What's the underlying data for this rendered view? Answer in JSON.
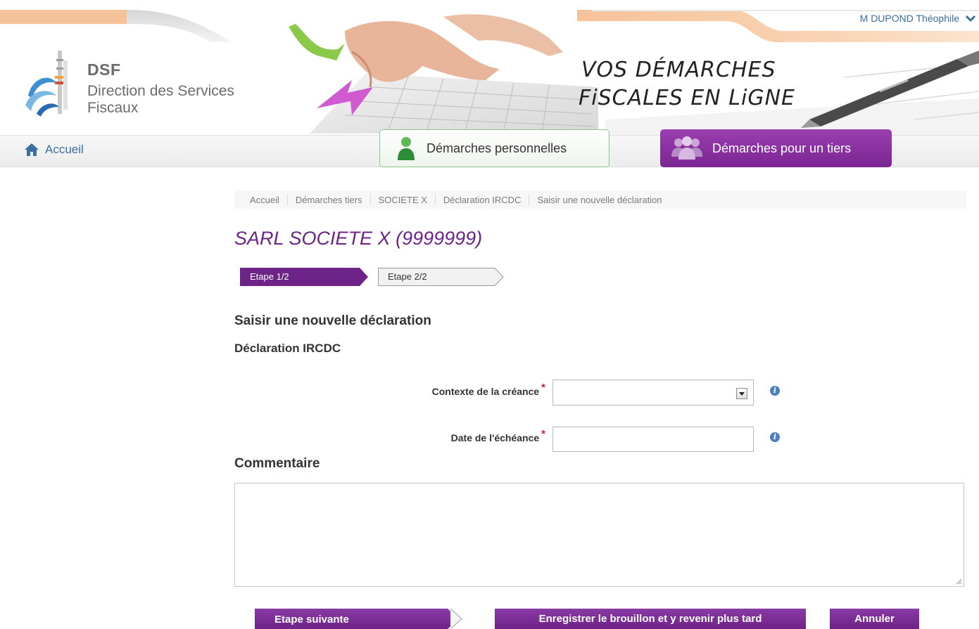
{
  "header": {
    "logo": {
      "acronym": "DSF",
      "line1": "Direction des Services",
      "line2": "Fiscaux"
    },
    "slogan": {
      "line1": "VOS DÉMARCHES",
      "line2": "FiSCALES EN LiGNE"
    },
    "user": {
      "name": "M DUPOND Théophile",
      "icon": "chevron-down-icon"
    }
  },
  "nav": {
    "home": {
      "label": "Accueil",
      "icon": "home-icon"
    },
    "tabs": [
      {
        "label": "Démarches personnelles",
        "icon": "person-icon",
        "active": false
      },
      {
        "label": "Démarches pour un tiers",
        "icon": "group-icon",
        "active": true
      }
    ]
  },
  "breadcrumb": [
    "Accueil",
    "Démarches tiers",
    "SOCIETE X",
    "Déclaration IRCDC",
    "Saisir une nouvelle déclaration"
  ],
  "page": {
    "entity_title": "SARL SOCIETE X (9999999)",
    "steps": [
      {
        "label": "Etape 1/2",
        "active": true
      },
      {
        "label": "Etape 2/2",
        "active": false
      }
    ],
    "heading": "Saisir une nouvelle déclaration",
    "subheading": "Déclaration IRCDC"
  },
  "form": {
    "contexte": {
      "label": "Contexte de la créance",
      "required_mark": "*",
      "value": ""
    },
    "date": {
      "label": "Date de l'échéance",
      "required_mark": "*",
      "value": ""
    },
    "comment": {
      "label": "Commentaire",
      "value": ""
    }
  },
  "actions": {
    "next": "Etape suivante",
    "draft": "Enregistrer le brouillon et y revenir plus tard",
    "cancel": "Annuler"
  },
  "colors": {
    "accent_purple": "#7a2592",
    "link_blue": "#3a6fa0",
    "green_border": "#8cc48c",
    "required_red": "#c0202a"
  }
}
